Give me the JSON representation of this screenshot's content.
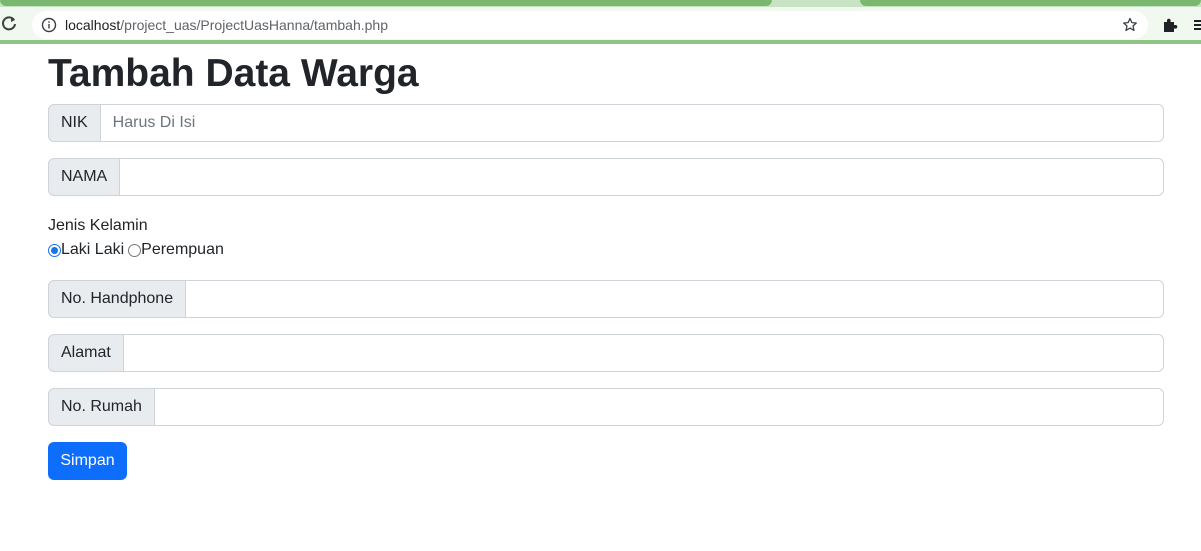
{
  "browser": {
    "url_host": "localhost",
    "url_path": "/project_uas/ProjectUasHanna/tambah.php",
    "icons": [
      "reload-icon",
      "info-icon",
      "star-icon",
      "extensions-icon",
      "menu-icon"
    ]
  },
  "page": {
    "title": "Tambah Data Warga",
    "fields": {
      "nik": {
        "label": "NIK",
        "placeholder": "Harus Di Isi",
        "value": ""
      },
      "nama": {
        "label": "NAMA",
        "value": ""
      },
      "handphone": {
        "label": "No. Handphone",
        "value": ""
      },
      "alamat": {
        "label": "Alamat",
        "value": ""
      },
      "rumah": {
        "label": "No. Rumah",
        "value": ""
      }
    },
    "gender": {
      "label": "Jenis Kelamin",
      "options": [
        {
          "label": "Laki Laki",
          "checked": true
        },
        {
          "label": "Perempuan",
          "checked": false
        }
      ]
    },
    "submit_label": "Simpan"
  },
  "colors": {
    "primary": "#0d6efd",
    "addon_bg": "#e9ecef",
    "border": "#ced4da",
    "chrome_green": "#8ec585"
  }
}
